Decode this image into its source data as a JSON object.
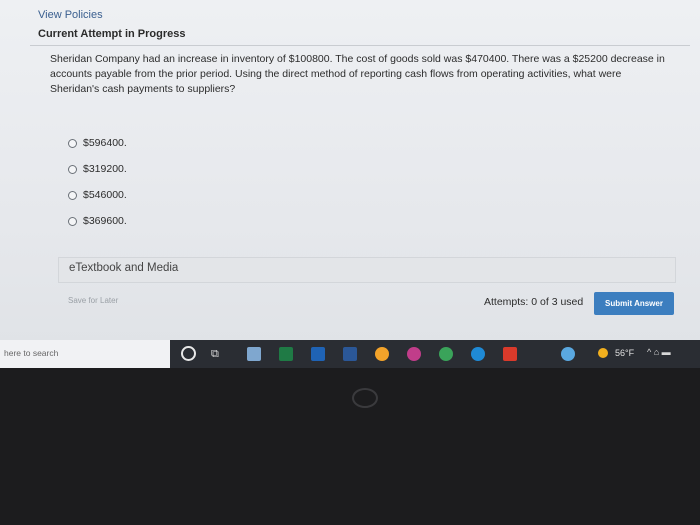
{
  "header": {
    "view_policies": "View Policies",
    "current_attempt": "Current Attempt in Progress"
  },
  "question": {
    "text": "Sheridan Company had an increase in inventory of $100800. The cost of goods sold was $470400. There was a $25200 decrease in accounts payable from the prior period. Using the direct method of reporting cash flows from operating activities, what were Sheridan's cash payments to suppliers?"
  },
  "options": [
    {
      "label": "$596400."
    },
    {
      "label": "$319200."
    },
    {
      "label": "$546000."
    },
    {
      "label": "$369600."
    }
  ],
  "etextbook": {
    "label": "eTextbook and Media"
  },
  "footer": {
    "save_later": "Save for Later",
    "attempts": "Attempts: 0 of 3 used",
    "submit": "Submit Answer"
  },
  "taskbar": {
    "search_placeholder": "here to search",
    "weather_temp": "56°F",
    "tray": "^ ⌂ ▬"
  },
  "colors": {
    "accent": "#3c7ebf",
    "taskbar": "#2a2d33"
  }
}
